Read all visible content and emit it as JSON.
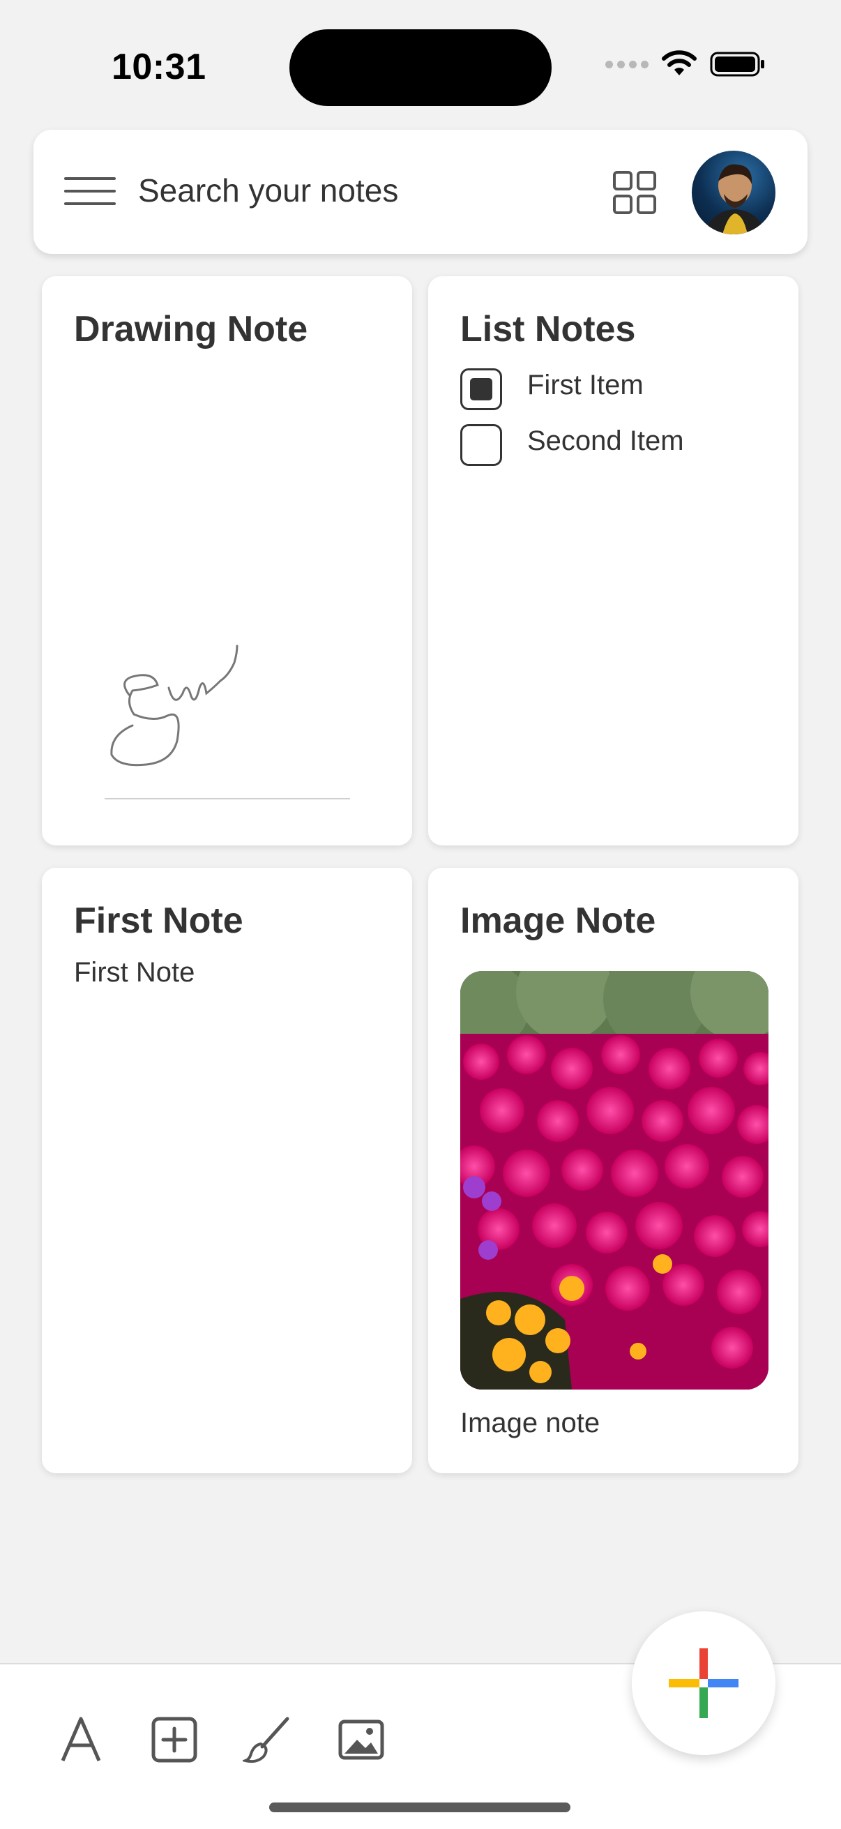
{
  "status_bar": {
    "time": "10:31"
  },
  "search": {
    "placeholder": "Search your notes"
  },
  "icons": {
    "menu": "hamburger-menu-icon",
    "view": "grid-view-icon",
    "avatar": "profile-avatar",
    "fab": "plus-icon",
    "toolbar": [
      "text-icon",
      "add-checkbox-icon",
      "brush-icon",
      "image-icon"
    ]
  },
  "notes": {
    "drawing": {
      "title": "Drawing Note"
    },
    "list": {
      "title": "List Notes",
      "items": [
        {
          "label": "First Item",
          "checked": true
        },
        {
          "label": "Second Item",
          "checked": false
        }
      ]
    },
    "first": {
      "title": "First Note",
      "body": "First Note"
    },
    "image": {
      "title": "Image Note",
      "caption": "Image note"
    }
  },
  "colors": {
    "background": "#f2f2f2",
    "card": "#ffffff",
    "text": "#333333",
    "fab_red": "#ea4335",
    "fab_blue": "#4285f4",
    "fab_green": "#34a853",
    "fab_yellow": "#fbbc05"
  }
}
